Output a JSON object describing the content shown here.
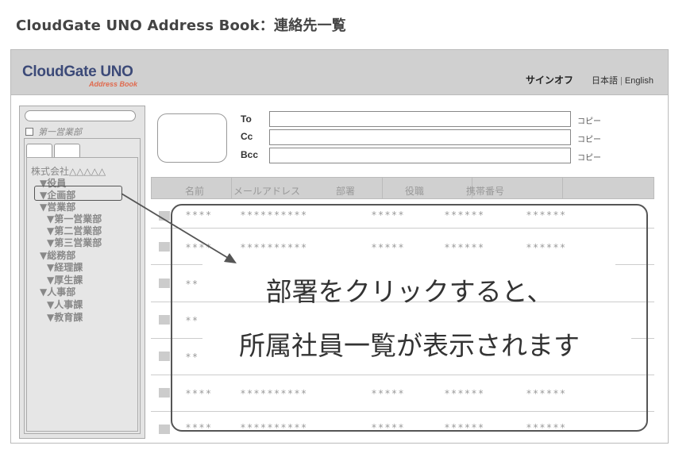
{
  "page_title": "CloudGate UNO Address Book：連絡先一覧",
  "header": {
    "logo_main": "CloudGate UNO",
    "logo_sub": "Address Book",
    "signoff": "サインオフ",
    "lang_ja": "日本語",
    "lang_sep": "|",
    "lang_en": "English"
  },
  "sidebar": {
    "dept_filter_label": "第一営業部",
    "tree": [
      "株式会社△△△△△",
      "▼役員",
      "▼企画部",
      "▼営業部",
      "▼第一営業部",
      "▼第二営業部",
      "▼第三営業部",
      "▼総務部",
      "▼経理課",
      "▼厚生課",
      "▼人事部",
      "▼人事課",
      "▼教育課"
    ]
  },
  "address": {
    "to_label": "To",
    "cc_label": "Cc",
    "bcc_label": "Bcc",
    "copy_label": "コピー"
  },
  "grid": {
    "columns": [
      "名前",
      "メールアドレス",
      "部署",
      "役職",
      "携帯番号"
    ],
    "rows": [
      [
        "****",
        "**********",
        "*****",
        "******",
        "******"
      ],
      [
        "****",
        "**********",
        "*****",
        "******",
        "******"
      ],
      [
        "**"
      ],
      [
        "**"
      ],
      [
        "**"
      ],
      [
        "****",
        "**********",
        "*****",
        "******",
        "******"
      ],
      [
        "****",
        "**********",
        "*****",
        "******",
        "******"
      ]
    ]
  },
  "callout": {
    "line1": "部署をクリックすると、",
    "line2": "所属社員一覧が表示されます"
  }
}
